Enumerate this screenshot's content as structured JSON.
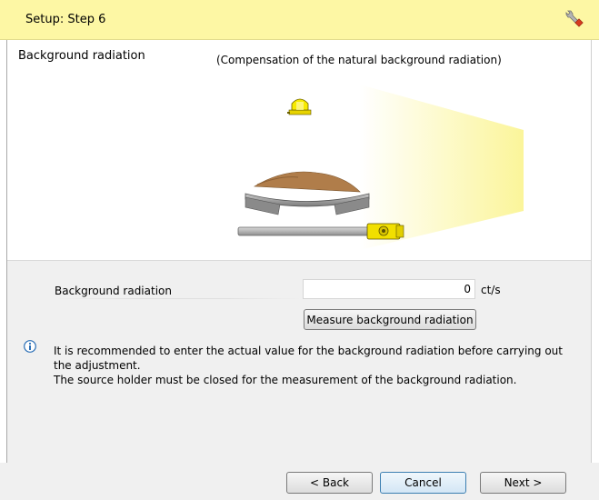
{
  "window": {
    "title": "Setup: Step 6",
    "icon": "wrench-icon"
  },
  "illustration": {
    "title": "Background radiation",
    "caption": "(Compensation of the natural background radiation)",
    "icons": [
      "warning-light-icon",
      "conveyor-belt-icon",
      "source-holder-icon",
      "radiation-beam-icon"
    ]
  },
  "form": {
    "label": "Background radiation",
    "value": "0",
    "unit": "ct/s",
    "measure_button": "Measure background radiation"
  },
  "info": {
    "icon": "info-icon",
    "line1": "It is recommended to enter the actual value for the background radiation before carrying out the adjustment.",
    "line2": "The source holder must be closed for the measurement of the background radiation."
  },
  "footer": {
    "back": "< Back",
    "cancel": "Cancel",
    "next": "Next >"
  },
  "colors": {
    "header_bg": "#fdf7a4",
    "panel_bg": "#f0f0f0",
    "accent_yellow": "#f5e400"
  }
}
